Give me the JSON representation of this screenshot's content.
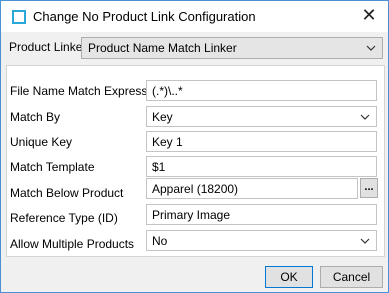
{
  "window": {
    "title": "Change No Product Link Configuration",
    "close_glyph": "✕"
  },
  "linker": {
    "label": "Product Linker",
    "value": "Product Name Match Linker"
  },
  "form": {
    "file_name_match_expression": {
      "label": "File Name Match Expression",
      "value": "(.*)\\..*"
    },
    "match_by": {
      "label": "Match By",
      "value": "Key"
    },
    "unique_key": {
      "label": "Unique Key",
      "value": "Key 1"
    },
    "match_template": {
      "label": "Match Template",
      "value": "$1"
    },
    "match_below_product": {
      "label": "Match Below Product",
      "value": "Apparel (18200)",
      "browse_label": "..."
    },
    "reference_type": {
      "label": "Reference Type (ID)",
      "value": "Primary Image"
    },
    "allow_multiple_products": {
      "label": "Allow Multiple Products",
      "value": "No"
    }
  },
  "buttons": {
    "ok": "OK",
    "cancel": "Cancel"
  },
  "icons": {
    "app": "window-icon",
    "dropdown": "chevron-down-icon"
  },
  "colors": {
    "accent": "#0078d7",
    "icon": "#2aa9d9"
  }
}
